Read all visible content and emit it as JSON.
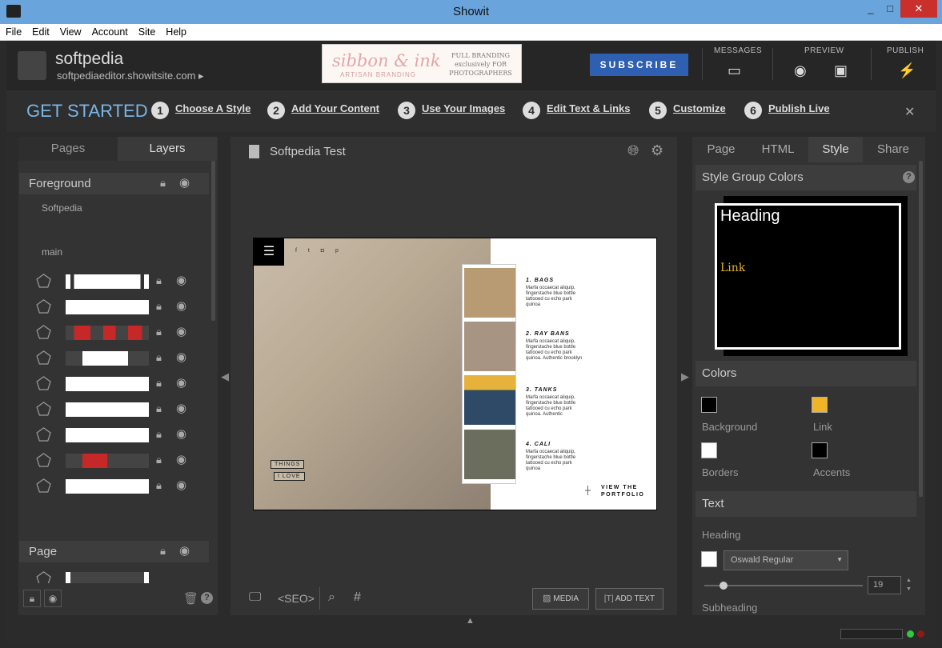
{
  "window": {
    "title": "Showit",
    "min": "_",
    "max": "□",
    "close": "✕"
  },
  "menu": [
    "File",
    "Edit",
    "View",
    "Account",
    "Site",
    "Help"
  ],
  "header": {
    "site_name": "softpedia",
    "site_url": "softpediaeditor.showitsite.com ▸",
    "banner": {
      "script": "sibbon & ink",
      "sub": "ARTISAN BRANDING",
      "right": "FULL BRANDING exclusively FOR PHOTOGRAPHERS"
    },
    "subscribe": "SUBSCRIBE",
    "messages": "MESSAGES",
    "preview": "PREVIEW",
    "publish": "PUBLISH"
  },
  "get_started": {
    "title": "GET STARTED",
    "steps": [
      {
        "num": "1",
        "label": "Choose A Style"
      },
      {
        "num": "2",
        "label": "Add Your Content"
      },
      {
        "num": "3",
        "label": "Use Your Images"
      },
      {
        "num": "4",
        "label": "Edit Text & Links"
      },
      {
        "num": "5",
        "label": "Customize"
      },
      {
        "num": "6",
        "label": "Publish Live"
      }
    ]
  },
  "left": {
    "tabs": [
      "Pages",
      "Layers"
    ],
    "section_foreground": "Foreground",
    "layer_softpedia": "Softpedia",
    "layer_main": "main",
    "section_page": "Page"
  },
  "center": {
    "doc_title": "Softpedia Test",
    "canvas": {
      "tag1": "THINGS",
      "tag2": "I LOVE",
      "items": [
        {
          "title": "1. BAGS",
          "desc": "Marfa occaecat aliquip, fingerstache blue bottle tattooed cu echo park quinoa"
        },
        {
          "title": "2. RAY BANS",
          "desc": "Marfa occaecat aliquip, fingerstache blue bottle tattooed cu echo park quinoa. Authentic brooklyn"
        },
        {
          "title": "3. TANKS",
          "desc": "Marfa occaecat aliquip, fingerstache blue bottle tattooed cu echo park quinoa. Authentic"
        },
        {
          "title": "4. CALI",
          "desc": "Marfa occaecat aliquip, fingerstache blue bottle tattooed cu echo park quinoa"
        }
      ],
      "view1": "VIEW THE",
      "view2": "PORTFOLIO"
    },
    "seo": "<SEO>",
    "media_btn": "MEDIA",
    "add_text_btn": "ADD TEXT"
  },
  "right": {
    "tabs": [
      "Page",
      "HTML",
      "Style",
      "Share"
    ],
    "style_group": "Style Group Colors",
    "preview_heading": "Heading",
    "preview_link": "Link",
    "colors_title": "Colors",
    "swatches": [
      {
        "label": "Background",
        "color": "#000000"
      },
      {
        "label": "Link",
        "color": "#f0b429"
      },
      {
        "label": "Borders",
        "color": "#ffffff"
      },
      {
        "label": "Accents",
        "color": "#000000"
      }
    ],
    "text_title": "Text",
    "heading_lbl": "Heading",
    "font": "Oswald Regular",
    "size": "19",
    "subheading_lbl": "Subheading"
  }
}
